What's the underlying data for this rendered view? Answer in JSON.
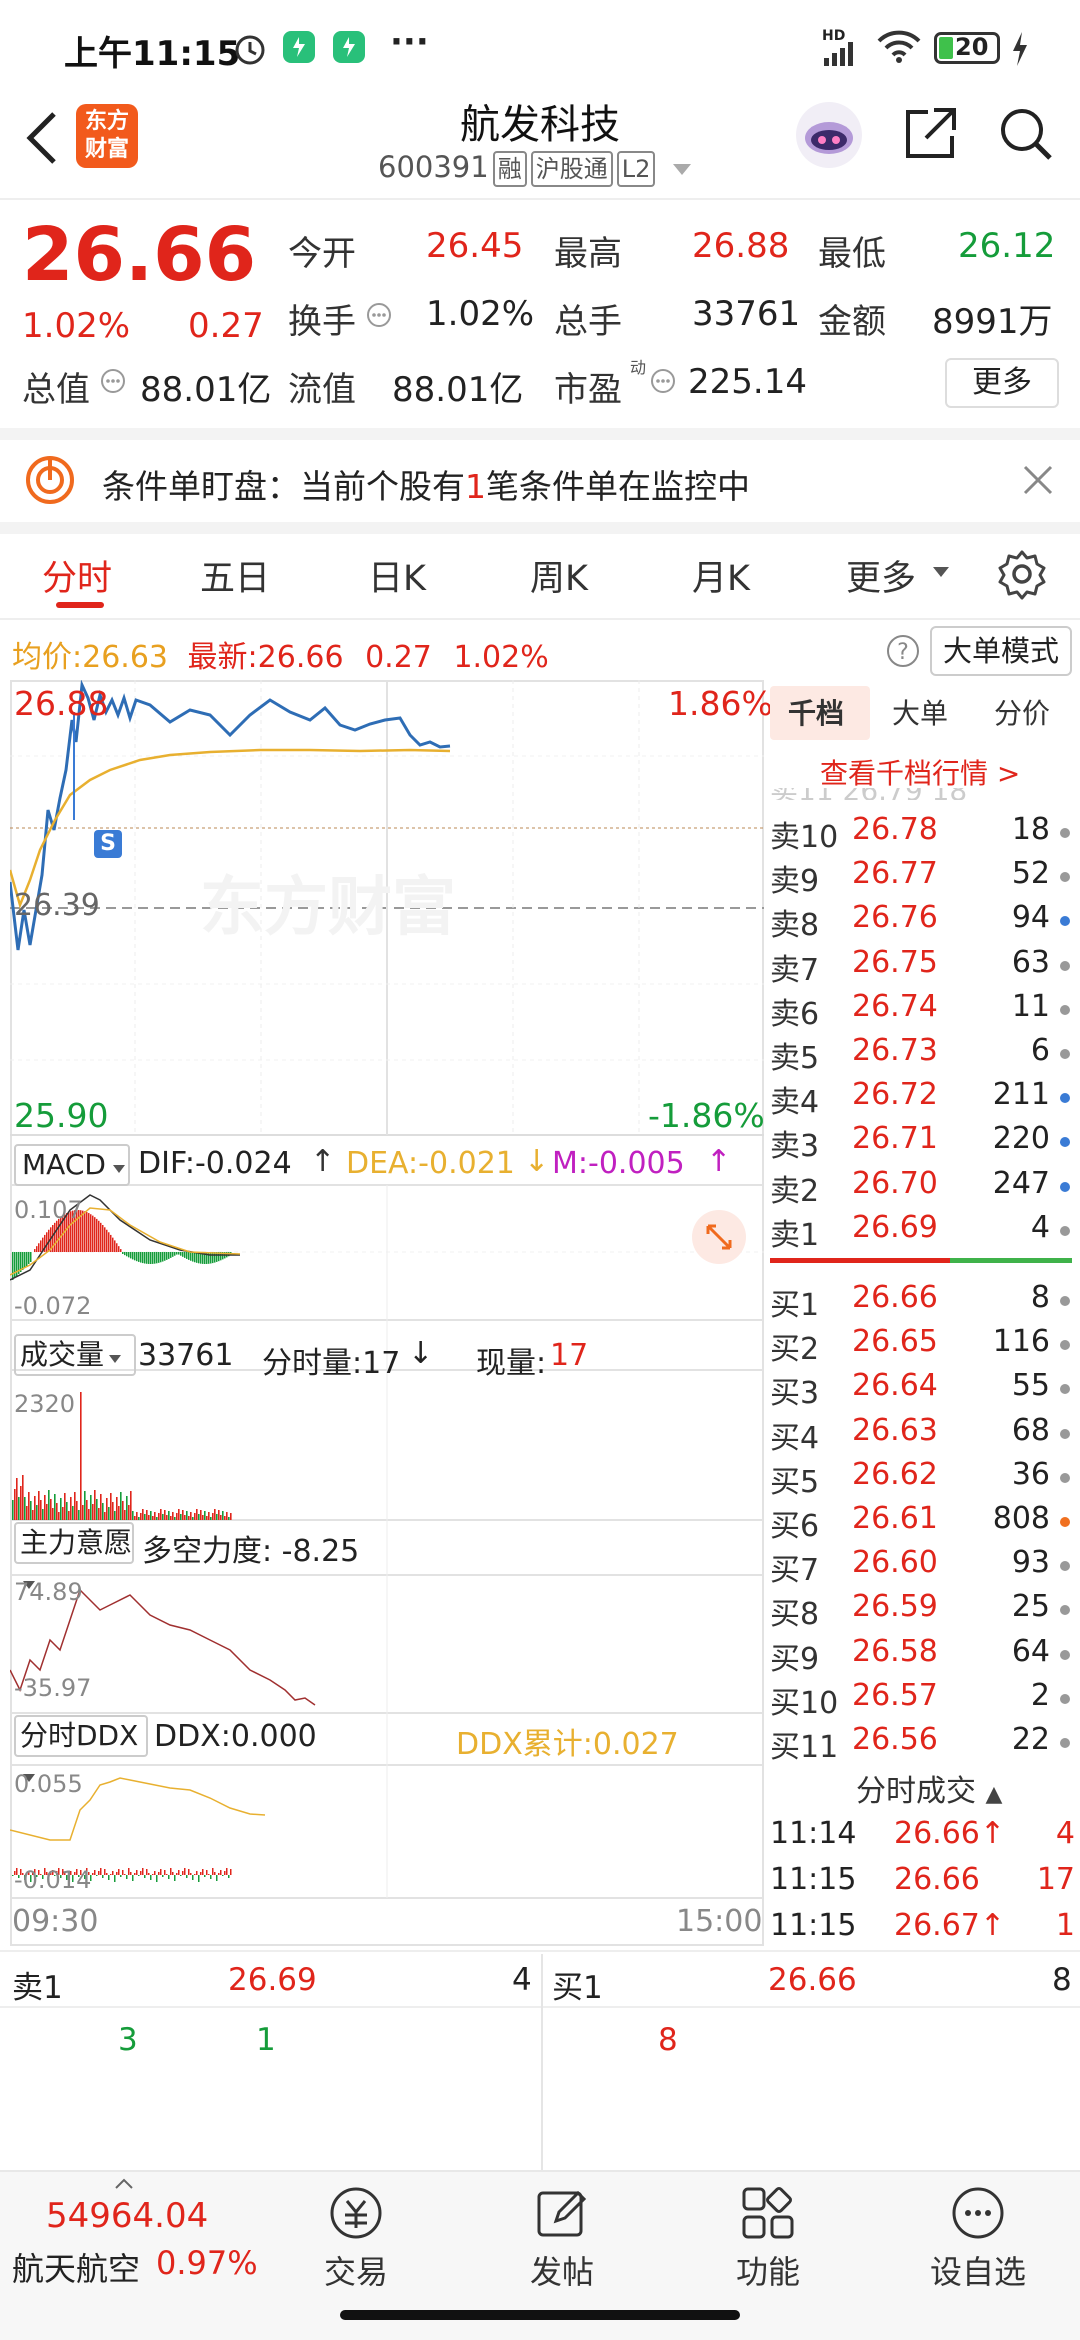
{
  "status_bar": {
    "time": "上午11:15",
    "more": "···",
    "network": "HD",
    "battery": "20"
  },
  "header": {
    "back": "<",
    "logo_line1": "东方",
    "logo_line2": "财富",
    "title": "航发科技",
    "code": "600391",
    "tags": [
      "融",
      "沪股通",
      "L2"
    ]
  },
  "quote": {
    "price": "26.66",
    "change_pct": "1.02%",
    "change": "0.27",
    "open_label": "今开",
    "open": "26.45",
    "high_label": "最高",
    "high": "26.88",
    "low_label": "最低",
    "low": "26.12",
    "turnover_label": "换手",
    "turnover": "1.02%",
    "volume_label": "总手",
    "volume": "33761",
    "amount_label": "金额",
    "amount": "8991万",
    "mktcap_label": "总值",
    "mktcap": "88.01亿",
    "float_label": "流值",
    "float": "88.01亿",
    "pe_label": "市盈",
    "pe_sup": "动",
    "pe": "225.14",
    "more_button": "更多"
  },
  "alert": {
    "prefix": "条件单盯盘：当前个股有",
    "count": "1",
    "suffix": "笔条件单在监控中"
  },
  "tabs": [
    "分时",
    "五日",
    "日K",
    "周K",
    "月K",
    "更多"
  ],
  "info_row": {
    "avg_label": "均价:",
    "avg": "26.63",
    "latest_label": "最新:",
    "latest": "26.66",
    "change": "0.27",
    "pct": "1.02%",
    "big_order_mode": "大单模式"
  },
  "chart": {
    "top_price": "26.88",
    "mid_price": "26.39",
    "low_price": "25.90",
    "top_pct": "1.86%",
    "low_pct": "-1.86%",
    "watermark": "东方财富",
    "s_marker": "S",
    "time_start": "09:30",
    "time_end": "15:00"
  },
  "macd": {
    "selector": "MACD",
    "dif": "DIF:-0.024",
    "dea": "DEA:-0.021",
    "m": "M:-0.005",
    "ymax": "0.107",
    "ymin": "-0.072"
  },
  "volume": {
    "selector": "成交量",
    "total": "33761",
    "min_vol": "分时量:17",
    "now_vol_label": "现量:",
    "now_vol": "17",
    "ymax": "2320"
  },
  "main_force": {
    "selector": "主力意愿",
    "strength": "多空力度: -8.25",
    "ymax": "74.89",
    "ymin": "-35.97"
  },
  "ddx": {
    "selector": "分时DDX",
    "ddx": "DDX:0.000",
    "ddx_cum": "DDX累计:0.027",
    "ymax": "0.055",
    "ymin": "-0.014"
  },
  "right_panel": {
    "tabs": [
      "千档",
      "大单",
      "分价"
    ],
    "link": "查看千档行情 >",
    "sells": [
      {
        "name": "卖10",
        "price": "26.78",
        "vol": "18",
        "dot": "#999"
      },
      {
        "name": "卖9",
        "price": "26.77",
        "vol": "52",
        "dot": "#999"
      },
      {
        "name": "卖8",
        "price": "26.76",
        "vol": "94",
        "dot": "#3a7bd5"
      },
      {
        "name": "卖7",
        "price": "26.75",
        "vol": "63",
        "dot": "#999"
      },
      {
        "name": "卖6",
        "price": "26.74",
        "vol": "11",
        "dot": "#999"
      },
      {
        "name": "卖5",
        "price": "26.73",
        "vol": "6",
        "dot": "#999"
      },
      {
        "name": "卖4",
        "price": "26.72",
        "vol": "211",
        "dot": "#3a7bd5"
      },
      {
        "name": "卖3",
        "price": "26.71",
        "vol": "220",
        "dot": "#3a7bd5"
      },
      {
        "name": "卖2",
        "price": "26.70",
        "vol": "247",
        "dot": "#3a7bd5"
      },
      {
        "name": "卖1",
        "price": "26.69",
        "vol": "4",
        "dot": "#999"
      }
    ],
    "buys": [
      {
        "name": "买1",
        "price": "26.66",
        "vol": "8",
        "dot": "#999"
      },
      {
        "name": "买2",
        "price": "26.65",
        "vol": "116",
        "dot": "#999"
      },
      {
        "name": "买3",
        "price": "26.64",
        "vol": "55",
        "dot": "#999"
      },
      {
        "name": "买4",
        "price": "26.63",
        "vol": "68",
        "dot": "#999"
      },
      {
        "name": "买5",
        "price": "26.62",
        "vol": "36",
        "dot": "#999"
      },
      {
        "name": "买6",
        "price": "26.61",
        "vol": "808",
        "dot": "#f07020"
      },
      {
        "name": "买7",
        "price": "26.60",
        "vol": "93",
        "dot": "#999"
      },
      {
        "name": "买8",
        "price": "26.59",
        "vol": "25",
        "dot": "#999"
      },
      {
        "name": "买9",
        "price": "26.58",
        "vol": "64",
        "dot": "#999"
      },
      {
        "name": "买10",
        "price": "26.57",
        "vol": "2",
        "dot": "#999"
      },
      {
        "name": "买11",
        "price": "26.56",
        "vol": "22",
        "dot": "#999"
      }
    ],
    "trades_title": "分时成交",
    "trades": [
      {
        "time": "11:14",
        "price": "26.66↑",
        "vol": "4"
      },
      {
        "time": "11:15",
        "price": "26.66",
        "vol": "17"
      },
      {
        "time": "11:15",
        "price": "26.67↑",
        "vol": "1"
      }
    ]
  },
  "bottom_quote": {
    "sell_label": "卖1",
    "sell_price": "26.69",
    "sell_vol": "4",
    "buy_label": "买1",
    "buy_price": "26.66",
    "buy_vol": "8",
    "sell_queue": [
      "3",
      "1"
    ],
    "buy_queue": [
      "8"
    ]
  },
  "bottom_nav": {
    "index_value": "54964.04",
    "index_name": "航天航空",
    "index_pct": "0.97%",
    "items": [
      "交易",
      "发帖",
      "功能",
      "设自选"
    ]
  },
  "colors": {
    "up": "#e0251b",
    "down": "#159c3a",
    "price_line": "#2e6db5",
    "avg_line": "#e8b030",
    "macd_dea": "#e8b030",
    "macd_m": "#c020c0"
  }
}
